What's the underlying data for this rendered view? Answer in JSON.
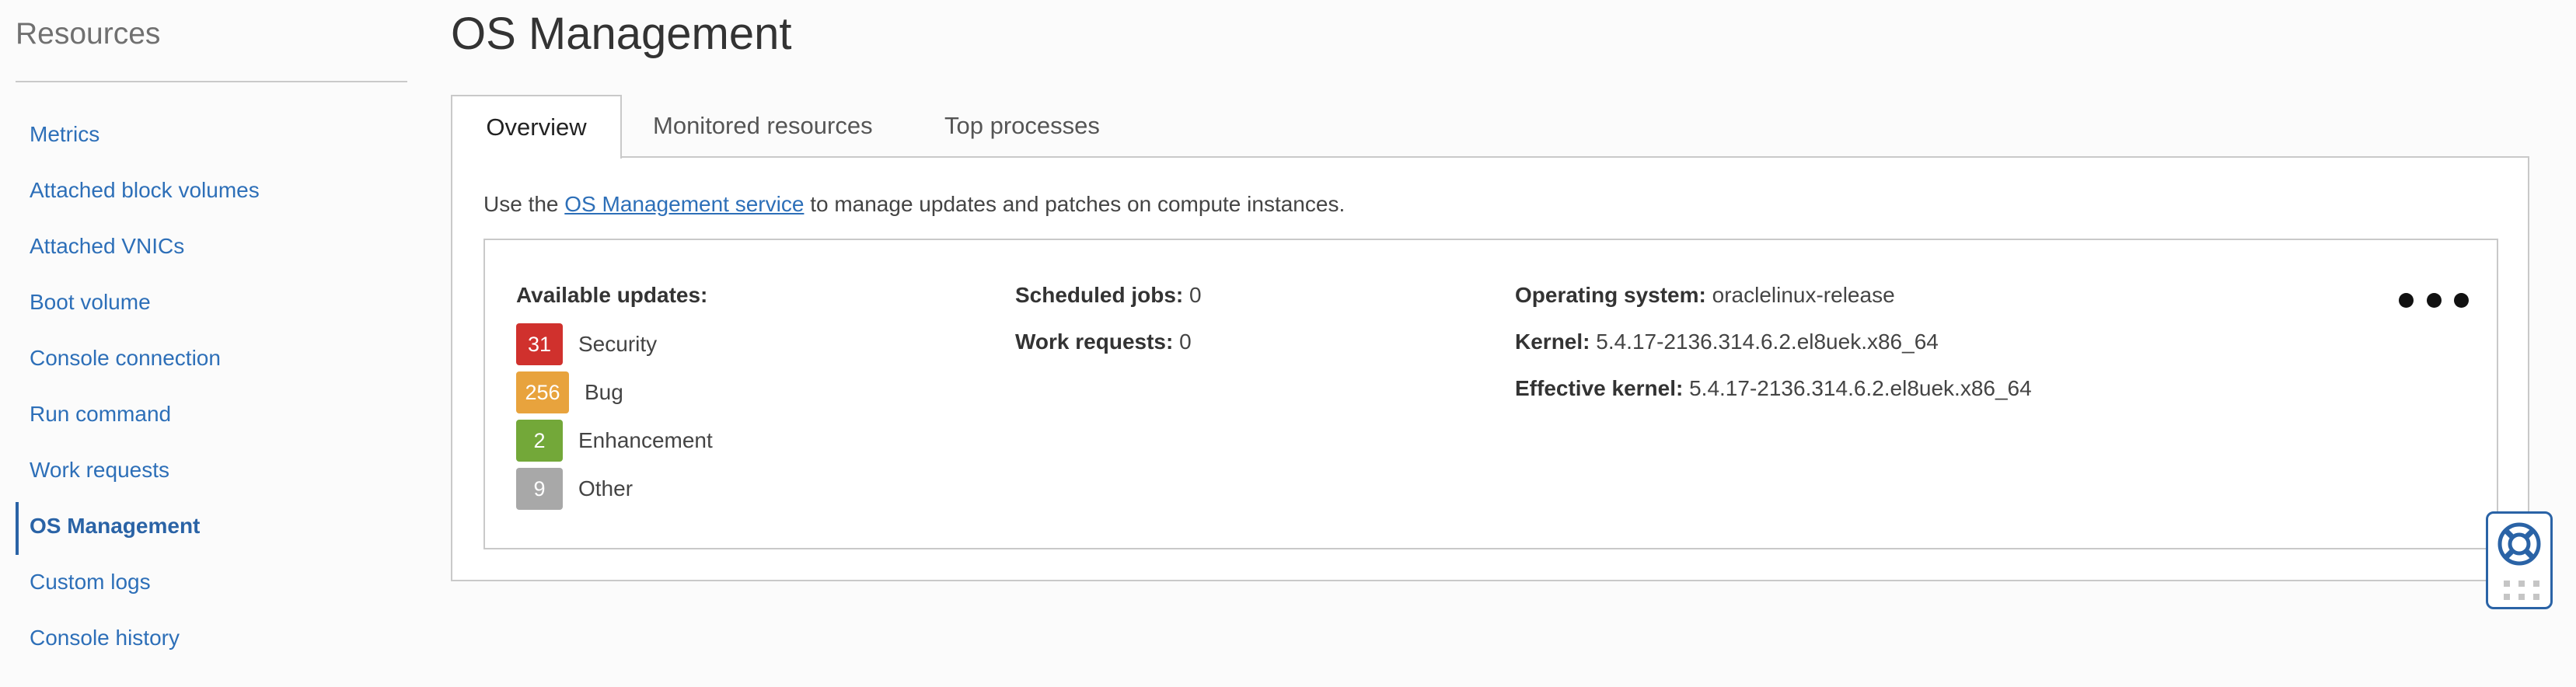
{
  "sidebar": {
    "title": "Resources",
    "items": [
      {
        "label": "Metrics",
        "active": false
      },
      {
        "label": "Attached block volumes",
        "active": false
      },
      {
        "label": "Attached VNICs",
        "active": false
      },
      {
        "label": "Boot volume",
        "active": false
      },
      {
        "label": "Console connection",
        "active": false
      },
      {
        "label": "Run command",
        "active": false
      },
      {
        "label": "Work requests",
        "active": false
      },
      {
        "label": "OS Management",
        "active": true
      },
      {
        "label": "Custom logs",
        "active": false
      },
      {
        "label": "Console history",
        "active": false
      }
    ]
  },
  "page": {
    "title": "OS Management"
  },
  "tabs": [
    {
      "label": "Overview",
      "active": true
    },
    {
      "label": "Monitored resources",
      "active": false
    },
    {
      "label": "Top processes",
      "active": false
    }
  ],
  "intro": {
    "prefix": "Use the ",
    "link": "OS Management service",
    "suffix": " to manage updates and patches on compute instances."
  },
  "updates": {
    "heading": "Available updates:",
    "items": [
      {
        "count": "31",
        "label": "Security",
        "color": "#d0312d"
      },
      {
        "count": "256",
        "label": "Bug",
        "color": "#e8a33d"
      },
      {
        "count": "2",
        "label": "Enhancement",
        "color": "#73a839"
      },
      {
        "count": "9",
        "label": "Other",
        "color": "#a8a8a8"
      }
    ]
  },
  "jobs": {
    "scheduled_label": "Scheduled jobs:",
    "scheduled_value": " 0",
    "work_label": "Work requests:",
    "work_value": " 0"
  },
  "system": {
    "os_label": "Operating system:",
    "os_value": " oraclelinux-release",
    "kernel_label": "Kernel:",
    "kernel_value": " 5.4.17-2136.314.6.2.el8uek.x86_64",
    "eff_label": "Effective kernel:",
    "eff_value": " 5.4.17-2136.314.6.2.el8uek.x86_64"
  },
  "icons": {
    "more": "more-options-icon",
    "help": "lifebuoy-icon",
    "grip": "drag-handle-icon"
  },
  "colors": {
    "accent": "#2a63a6",
    "link": "#2d6fb8"
  }
}
